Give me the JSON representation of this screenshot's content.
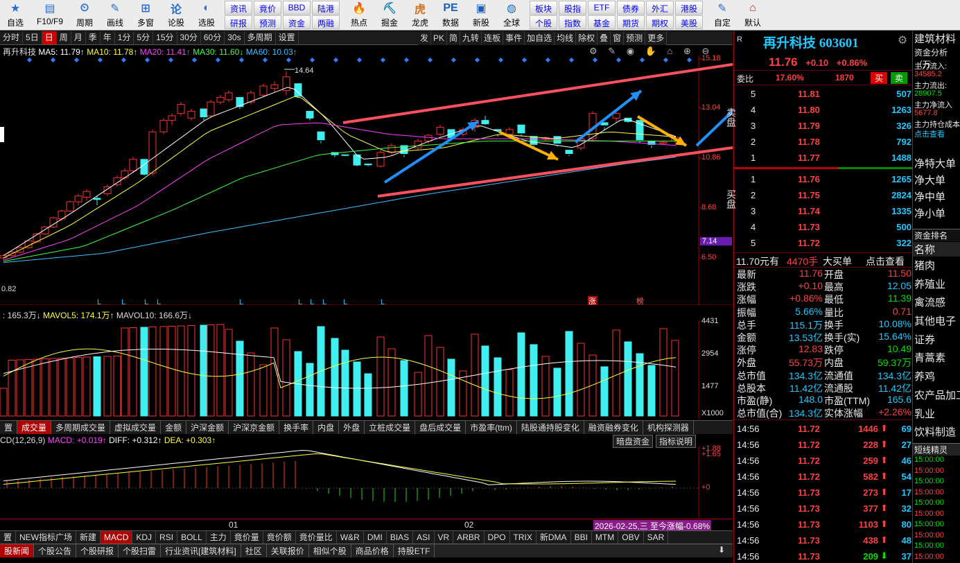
{
  "toolbar": {
    "buttons": [
      {
        "name": "zixuan",
        "label": "自选",
        "icon": "star-icon"
      },
      {
        "name": "f10",
        "label": "F10/F9",
        "icon": "f10-icon"
      },
      {
        "name": "zhouqi",
        "label": "周期",
        "icon": "clock-icon"
      },
      {
        "name": "huaxian",
        "label": "画线",
        "icon": "pencil-icon"
      },
      {
        "name": "duoguan",
        "label": "多窗",
        "icon": "grid-icon"
      },
      {
        "name": "lungu",
        "label": "论股",
        "icon": "chat-icon"
      },
      {
        "name": "xuangu",
        "label": "选股",
        "icon": "select-icon"
      }
    ],
    "grid1": [
      "资讯",
      "研报",
      "竟价",
      "预测",
      "BBD",
      "资金",
      "陆港",
      "两融"
    ],
    "buttons2": [
      {
        "name": "redian",
        "label": "热点",
        "icon": "hot-icon"
      },
      {
        "name": "juejin",
        "label": "掘金",
        "icon": "gold-icon"
      },
      {
        "name": "longhu",
        "label": "龙虎",
        "icon": "tiger-icon"
      },
      {
        "name": "shuju",
        "label": "数据",
        "icon": "pe-icon"
      },
      {
        "name": "xingu",
        "label": "新股",
        "icon": "ipo-icon"
      },
      {
        "name": "quanqiu",
        "label": "全球",
        "icon": "globe-icon"
      }
    ],
    "grid2": [
      "板块",
      "个股",
      "股指",
      "指数",
      "ETF",
      "基金",
      "债券",
      "期货",
      "外汇",
      "期权",
      "港股",
      "美股"
    ],
    "buttons3": [
      {
        "name": "zidingyi",
        "label": "自定",
        "icon": "custom-icon"
      },
      {
        "name": "moren",
        "label": "默认",
        "icon": "home-icon"
      }
    ]
  },
  "periodbar": [
    "分时",
    "5日",
    "日",
    "周",
    "月",
    "季",
    "年",
    "1分",
    "5分",
    "15分",
    "30分",
    "60分",
    "30s",
    "多周期",
    "设置"
  ],
  "periodbar_active": "日",
  "toolbar_right": [
    "发",
    "PK",
    "简",
    "九转",
    "连板",
    "事件",
    "加自选",
    "均线",
    "除权",
    "叠",
    "窗",
    "预测",
    "更多"
  ],
  "ma_legend": {
    "stock": "再升科技",
    "ma5": "MA5: 11.79↑",
    "ma10": "MA10: 11.78↑",
    "ma20": "MA20: 11.41↑",
    "ma30": "MA30: 11.60↓",
    "ma60": "MA60: 10.03↑"
  },
  "vol_legend": {
    "vol": ": 165.3万↓",
    "mavol5": "MAVOL5: 174.1万↑",
    "mavol10": "MAVOL10: 166.6万↓"
  },
  "macd_legend": {
    "title": "CD(12,26,9)",
    "macd": "MACD: +0.019↑",
    "diff": "DIFF: +0.312↑",
    "dea": "DEA: +0.303↑"
  },
  "price_axis": [
    "15.18",
    "13.04",
    "10.86",
    "8.68",
    "6.50"
  ],
  "price_axis_highlight": "7.14",
  "vol_axis": [
    "4431",
    "2954",
    "1477",
    "X1000"
  ],
  "macd_axis": [
    "+1.88",
    "+1.65",
    "+0"
  ],
  "date_axis": [
    "01",
    "02"
  ],
  "date_tip": "2026-02-25,三 至今涨幅-0.68%",
  "high_label": "14.64",
  "low_label": "0.82",
  "markers": {
    "L": "L",
    "zhang": "涨",
    "bang": "榜"
  },
  "macd_buttons": [
    "暗盘资金",
    "指标说明"
  ],
  "tabs1": [
    "置",
    "成交量",
    "多周期成交量",
    "虚拟成交量",
    "金额",
    "沪深金额",
    "沪深京金额",
    "换手率",
    "内盘",
    "外盘",
    "立桩成交量",
    "盘后成交量",
    "市盈率(ttm)",
    "陆股通持股变化",
    "融资融券变化",
    "机构探测器"
  ],
  "tabs1_active": "成交量",
  "tabs2": [
    "置",
    "NEW指标广场",
    "新建",
    "MACD",
    "KDJ",
    "RSI",
    "BOLL",
    "主力",
    "竟价量",
    "竟价额",
    "竟价量比",
    "W&R",
    "DMI",
    "BIAS",
    "ASI",
    "VR",
    "ARBR",
    "DPO",
    "TRIX",
    "新DMA",
    "BBI",
    "MTM",
    "OBV",
    "SAR"
  ],
  "tabs2_active": "MACD",
  "tabs3": [
    "股新闻",
    "个股公告",
    "个股研报",
    "个股扫雷",
    "行业资讯[建筑材料]",
    "社区",
    "关联报价",
    "相似个股",
    "商品价格",
    "持股ETF"
  ],
  "tabs3_active": "股新闻",
  "quote": {
    "title": "再升科技 603601",
    "price": "11.76",
    "change": "+0.10",
    "pct": "+0.86%",
    "weibi_label": "委比",
    "weibi": "17.60%",
    "weicha": "1870",
    "buy": "买",
    "sell": "卖",
    "sell_side_label": "卖盘",
    "buy_side_label": "买盘",
    "asks": [
      {
        "n": "5",
        "p": "11.81",
        "v": "507"
      },
      {
        "n": "4",
        "p": "11.80",
        "v": "1263"
      },
      {
        "n": "3",
        "p": "11.79",
        "v": "326"
      },
      {
        "n": "2",
        "p": "11.78",
        "v": "792"
      },
      {
        "n": "1",
        "p": "11.77",
        "v": "1488"
      }
    ],
    "bids": [
      {
        "n": "1",
        "p": "11.76",
        "v": "1265"
      },
      {
        "n": "2",
        "p": "11.75",
        "v": "2824"
      },
      {
        "n": "3",
        "p": "11.74",
        "v": "1335"
      },
      {
        "n": "4",
        "p": "11.73",
        "v": "500"
      },
      {
        "n": "5",
        "p": "11.72",
        "v": "322"
      }
    ],
    "bigorder": {
      "a": "11.70元有",
      "b": "4470手",
      "c": "大买单",
      "d": "点击查看"
    },
    "stats": [
      [
        "最新",
        "11.76",
        "开盘",
        "11.50"
      ],
      [
        "涨跌",
        "+0.10",
        "最高",
        "12.05"
      ],
      [
        "涨幅",
        "+0.86%",
        "最低",
        "11.39"
      ],
      [
        "振幅",
        "5.66%",
        "量比",
        "0.71"
      ],
      [
        "总手",
        "115.1万",
        "换手",
        "10.08%"
      ],
      [
        "金额",
        "13.53亿",
        "换手(实)",
        "15.64%"
      ],
      [
        "涨停",
        "12.83",
        "跌停",
        "10.49"
      ],
      [
        "外盘",
        "55.73万",
        "内盘",
        "59.37万"
      ],
      [
        "总市值",
        "134.3亿",
        "流通值",
        "134.3亿"
      ],
      [
        "总股本",
        "11.42亿",
        "流通股",
        "11.42亿"
      ],
      [
        "市盈(静)",
        "148.0",
        "市盈(TTM)",
        "165.6"
      ],
      [
        "总市值(合)",
        "134.3亿",
        "实体涨幅",
        "+2.26%"
      ]
    ],
    "ticks": [
      {
        "t": "14:56",
        "p": "11.72",
        "v": "1446",
        "d": "69",
        "up": true
      },
      {
        "t": "14:56",
        "p": "11.72",
        "v": "228",
        "d": "27",
        "up": true
      },
      {
        "t": "14:56",
        "p": "11.72",
        "v": "259",
        "d": "46",
        "up": true
      },
      {
        "t": "14:56",
        "p": "11.72",
        "v": "582",
        "d": "54",
        "up": true
      },
      {
        "t": "14:56",
        "p": "11.73",
        "v": "273",
        "d": "17",
        "up": true
      },
      {
        "t": "14:56",
        "p": "11.73",
        "v": "377",
        "d": "32",
        "up": true
      },
      {
        "t": "14:56",
        "p": "11.73",
        "v": "1103",
        "d": "80",
        "up": true
      },
      {
        "t": "14:56",
        "p": "11.73",
        "v": "438",
        "d": "48",
        "up": true
      },
      {
        "t": "14:56",
        "p": "11.73",
        "v": "209",
        "d": "37",
        "up": false
      }
    ]
  },
  "side": {
    "industry": "建筑材料",
    "fund_title": "资金分析（万",
    "items": [
      {
        "label": "主力流入:",
        "value": "34585.2",
        "color": "#ff4040"
      },
      {
        "label": "主力流出:",
        "value": "28907.5",
        "color": "#00e000"
      },
      {
        "label": "主力净流入",
        "value": "5677.8",
        "color": "#ff4040"
      },
      {
        "label": "主力持仓成本",
        "value": "点击查看",
        "color": "#20c8ff"
      }
    ],
    "net": [
      "净特大单",
      "净大单",
      "净中单",
      "净小单"
    ],
    "rank_title": "资金排名",
    "rank_header": "名称",
    "rank": [
      "猪肉",
      "养殖业",
      "禽流感",
      "其他电子",
      "证券",
      "青蒿素",
      "养鸡",
      "农产品加工",
      "乳业",
      "饮料制造"
    ],
    "short_title": "短线精灵",
    "short_times": [
      "15:00:00",
      "15:00:00",
      "15:00:00",
      "15:00:00",
      "15:00:00",
      "15:00:00",
      "15:00:00",
      "15:00:00",
      "15:00:00",
      "15:00:00",
      "15:00:00",
      "15:00:00"
    ]
  }
}
